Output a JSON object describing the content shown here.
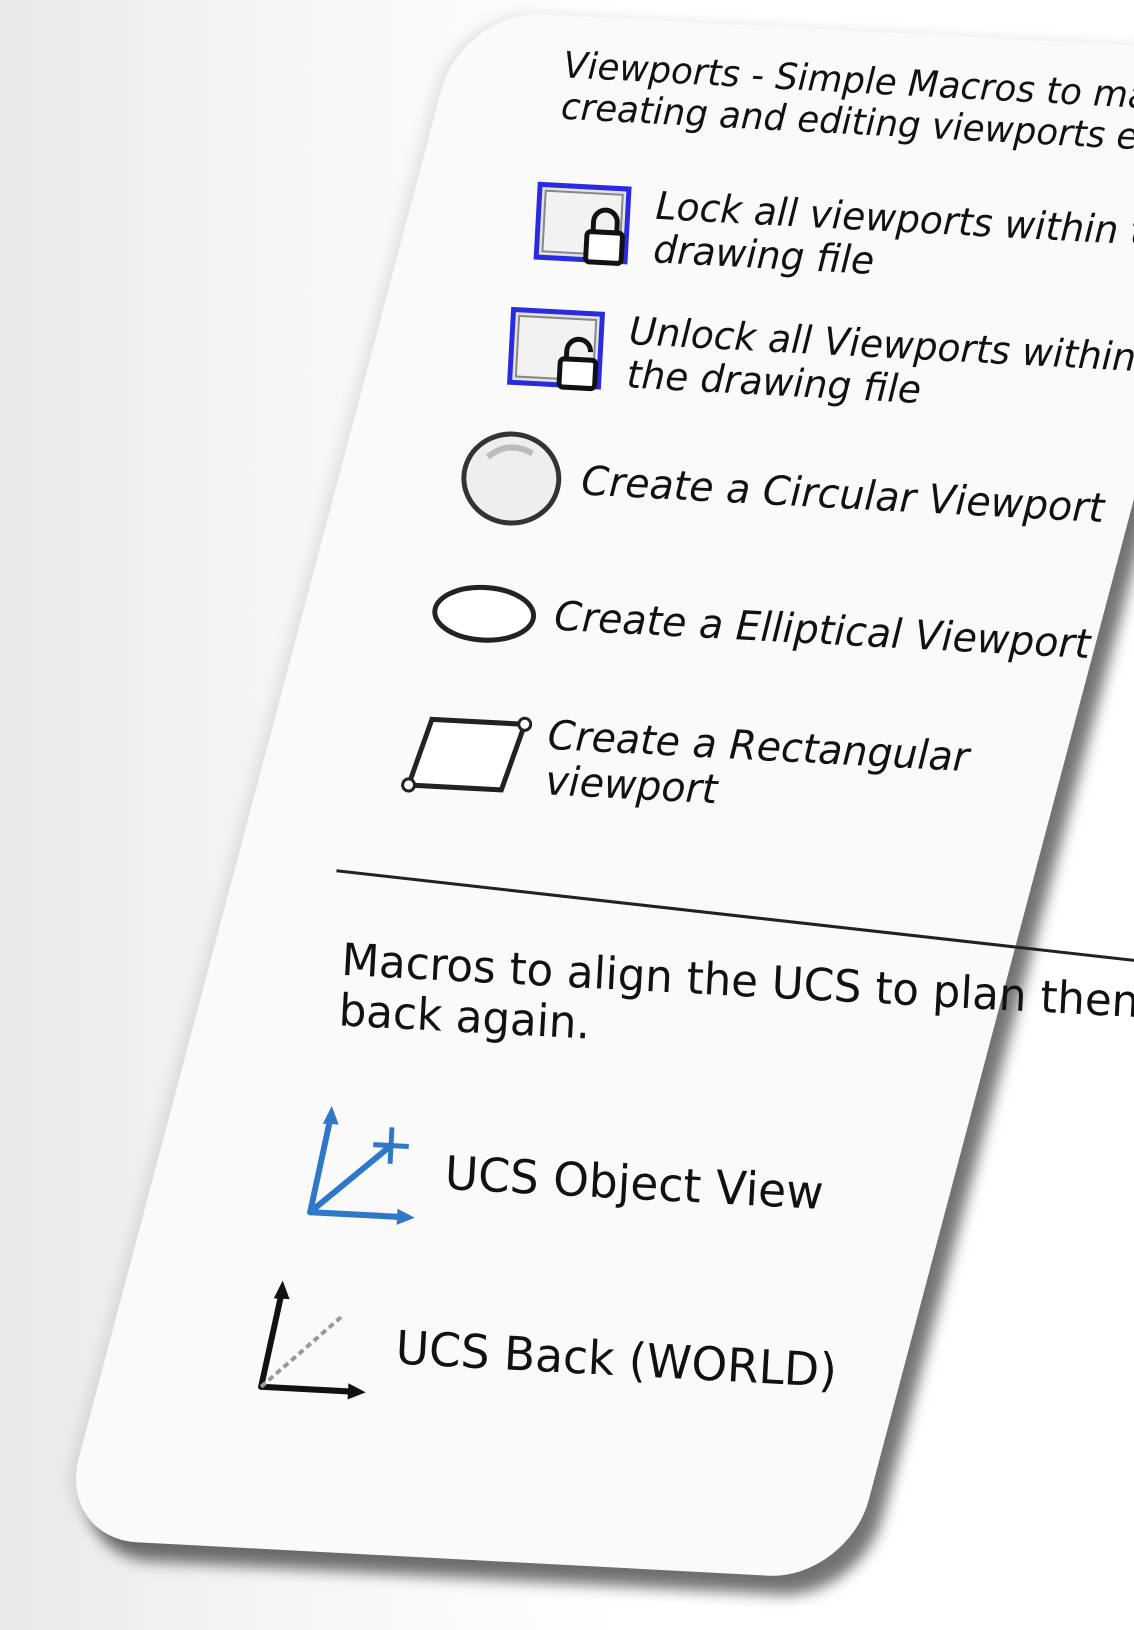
{
  "section_viewports": {
    "title": "Viewports - Simple Macros to made creating and editing viewports easy"
  },
  "tools": {
    "lock": {
      "label": "Lock all viewports within the drawing file",
      "icon": "viewport-lock-icon"
    },
    "unlock": {
      "label": "Unlock all Viewports within the drawing file",
      "icon": "viewport-unlock-icon"
    },
    "circular": {
      "label": "Create a Circular Viewport",
      "icon": "circle-icon"
    },
    "elliptical": {
      "label": "Create a Elliptical Viewport",
      "icon": "ellipse-icon"
    },
    "rectangular": {
      "label": "Create a Rectangular viewport",
      "icon": "rectangle-icon"
    }
  },
  "section_ucs": {
    "title": "Macros to align the UCS to plan then back again."
  },
  "ucs_tools": {
    "object_view": {
      "label": "UCS Object View",
      "icon": "ucs-object-icon"
    },
    "back_world": {
      "label": "UCS Back (WORLD)",
      "icon": "ucs-world-icon"
    }
  },
  "colors": {
    "viewport_frame": "#2a2ae0",
    "ucs_blue": "#2f78c8",
    "text": "#111111"
  }
}
